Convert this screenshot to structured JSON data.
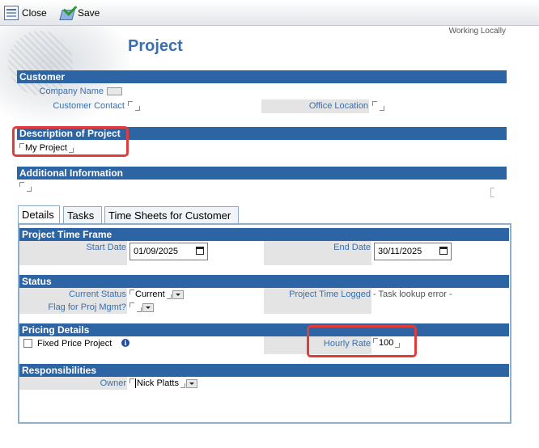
{
  "toolbar": {
    "close_label": "Close",
    "save_label": "Save"
  },
  "status_text": "Working Locally",
  "page_title": "Project",
  "customer": {
    "header": "Customer",
    "company_name_label": "Company Name",
    "customer_contact_label": "Customer Contact",
    "office_location_label": "Office Location"
  },
  "description": {
    "header": "Description of Project",
    "value": "My Project"
  },
  "additional": {
    "header": "Additional Information"
  },
  "tabs": [
    {
      "label": "Details",
      "active": true
    },
    {
      "label": "Tasks",
      "active": false
    },
    {
      "label": "Time Sheets for Customer",
      "active": false
    }
  ],
  "time_frame": {
    "header": "Project Time Frame",
    "start_label": "Start Date",
    "start_value": "01/09/2025",
    "end_label": "End Date",
    "end_value": "30/11/2025"
  },
  "status": {
    "header": "Status",
    "current_status_label": "Current Status",
    "current_status_value": "Current",
    "flag_label": "Flag for Proj Mgmt?",
    "time_logged_label": "Project Time Logged",
    "time_logged_value": "- Task lookup error -"
  },
  "pricing": {
    "header": "Pricing Details",
    "fixed_price_label": "Fixed Price Project",
    "fixed_price_checked": false,
    "hourly_rate_label": "Hourly Rate",
    "hourly_rate_value": "100"
  },
  "responsibilities": {
    "header": "Responsibilities",
    "owner_label": "Owner",
    "owner_value": "Nick Platts"
  },
  "colors": {
    "header_bar": "#2d64a3",
    "label_text": "#3a6fb0",
    "highlight": "#e03c3c"
  }
}
